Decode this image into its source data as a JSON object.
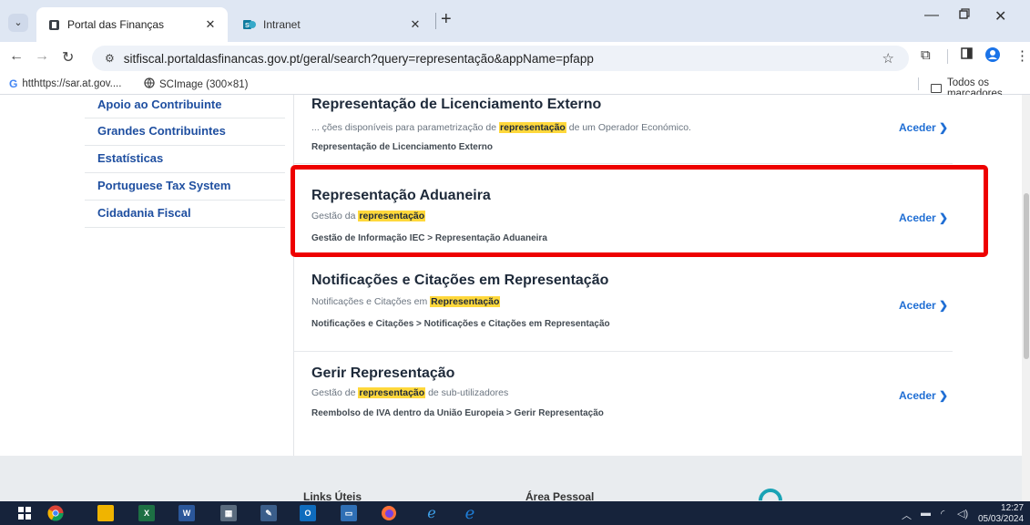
{
  "browser": {
    "tabs": [
      {
        "title": "Portal das Finanças",
        "active": true,
        "icon": "portal-favicon"
      },
      {
        "title": "Intranet",
        "active": false,
        "icon": "sharepoint-favicon"
      }
    ],
    "address": {
      "url": "sitfiscal.portaldasfinancas.gov.pt/geral/search?query=representação&appName=pfapp"
    },
    "bookmarks": [
      {
        "label": "htthttps://sar.at.gov....",
        "icon": "google-icon"
      },
      {
        "label": "SCImage (300×81)",
        "icon": "globe-icon"
      }
    ],
    "all_bookmarks_label": "Todos os marcadores"
  },
  "sidebar": {
    "items": [
      {
        "label": "Apoio ao Contribuinte"
      },
      {
        "label": "Grandes Contribuintes"
      },
      {
        "label": "Estatísticas"
      },
      {
        "label": "Portuguese Tax System"
      },
      {
        "label": "Cidadania Fiscal"
      }
    ]
  },
  "results": [
    {
      "title": "Representação de Licenciamento Externo",
      "snippet_before": "... ções disponíveis para parametrização de ",
      "snippet_highlight": "representação",
      "snippet_after": " de um Operador Económico.",
      "path": "Representação de Licenciamento Externo",
      "action": "Aceder ❯"
    },
    {
      "title": "Representação Aduaneira",
      "snippet_before": "Gestão da ",
      "snippet_highlight": "representação",
      "snippet_after": "",
      "path": "Gestão de Informação IEC > Representação Aduaneira",
      "action": "Aceder ❯"
    },
    {
      "title": "Notificações e Citações em Representação",
      "snippet_before": "Notificações e Citações em ",
      "snippet_highlight": "Representação",
      "snippet_after": "",
      "path": "Notificações e Citações > Notificações e Citações em Representação",
      "action": "Aceder ❯"
    },
    {
      "title": "Gerir Representação",
      "snippet_before": "Gestão de ",
      "snippet_highlight": "representação",
      "snippet_after": " de sub-utilizadores",
      "path": "Reembolso de IVA dentro da União Europeia > Gerir Representação",
      "action": "Aceder ❯"
    }
  ],
  "footer": {
    "links_label": "Links Úteis",
    "personal_label": "Área Pessoal"
  },
  "taskbar": {
    "time": "12:27",
    "date": "05/03/2024"
  },
  "colors": {
    "highlight": "#ffd83b",
    "annotation_box": "#ee0000",
    "link_blue": "#1f6ed4",
    "sidebar_blue": "#1f4fa0"
  }
}
